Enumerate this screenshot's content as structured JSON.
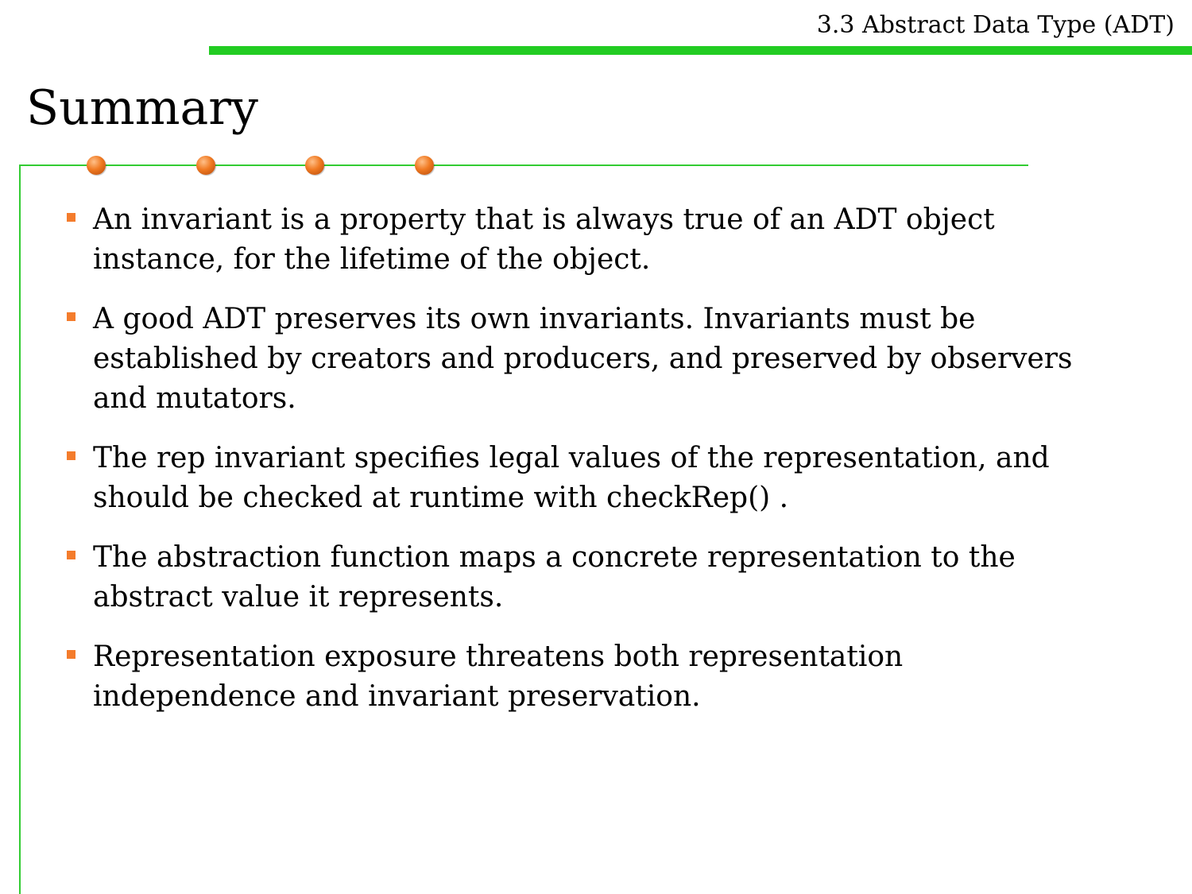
{
  "header": {
    "section_title": "3.3 Abstract Data Type (ADT)"
  },
  "page": {
    "title": "Summary"
  },
  "bullets": [
    {
      "lines": [
        "An invariant is a property that is always true of an ADT object",
        "instance, for the lifetime of the object."
      ]
    },
    {
      "lines": [
        "A good ADT preserves its own invariants. Invariants must be",
        "established by creators and producers, and preserved by observers",
        "and mutators."
      ]
    },
    {
      "lines": [
        "The rep invariant specifies legal values of the representation, and",
        "should be checked at runtime with checkRep() ."
      ]
    },
    {
      "lines": [
        "The abstraction function maps a concrete representation to the",
        "abstract value it represents."
      ]
    },
    {
      "lines": [
        "Representation exposure threatens both representation",
        "independence and invariant preservation."
      ]
    }
  ],
  "colors": {
    "header_rule": "#22cc22",
    "frame": "#33cc33",
    "bullet_marker": "#f47c2c",
    "dot": "#f07a22"
  }
}
